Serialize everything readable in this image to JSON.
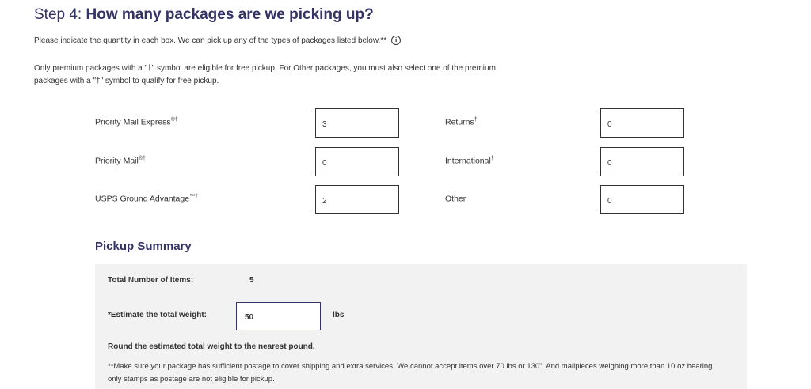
{
  "header": {
    "step_prefix": "Step 4: ",
    "title": "How many packages are we picking up?"
  },
  "intro": {
    "text": "Please indicate the quantity in each box. We can pick up any of the types of packages listed below.**",
    "info_icon": "info-circle-icon"
  },
  "note": {
    "text": "Only premium packages with a \"†\" symbol are eligible for free pickup. For Other packages, you must also select one of the premium packages with a \"†\" symbol to qualify for free pickup."
  },
  "packages": [
    {
      "label": "Priority Mail Express",
      "mark": "®†",
      "value": "3"
    },
    {
      "label": "Priority Mail",
      "mark": "®†",
      "value": "0"
    },
    {
      "label": "USPS Ground Advantage",
      "mark": "™†",
      "value": "2"
    },
    {
      "label": "Returns",
      "mark": "†",
      "value": "0"
    },
    {
      "label": "International",
      "mark": "†",
      "value": "0"
    },
    {
      "label": "Other",
      "mark": "",
      "value": "0"
    }
  ],
  "summary": {
    "title": "Pickup Summary",
    "total_label": "Total Number of Items:",
    "total_value": "5",
    "weight_label": "*Estimate the total weight:",
    "weight_value": "50",
    "weight_unit": "lbs",
    "round_note": "Round the estimated total weight to the nearest pound.",
    "fine_print": "**Make sure your package has sufficient postage to cover shipping and extra services. We cannot accept items over 70 lbs or 130\". And mailpieces weighing more than 10 oz bearing only stamps as postage are not eligible for pickup."
  }
}
